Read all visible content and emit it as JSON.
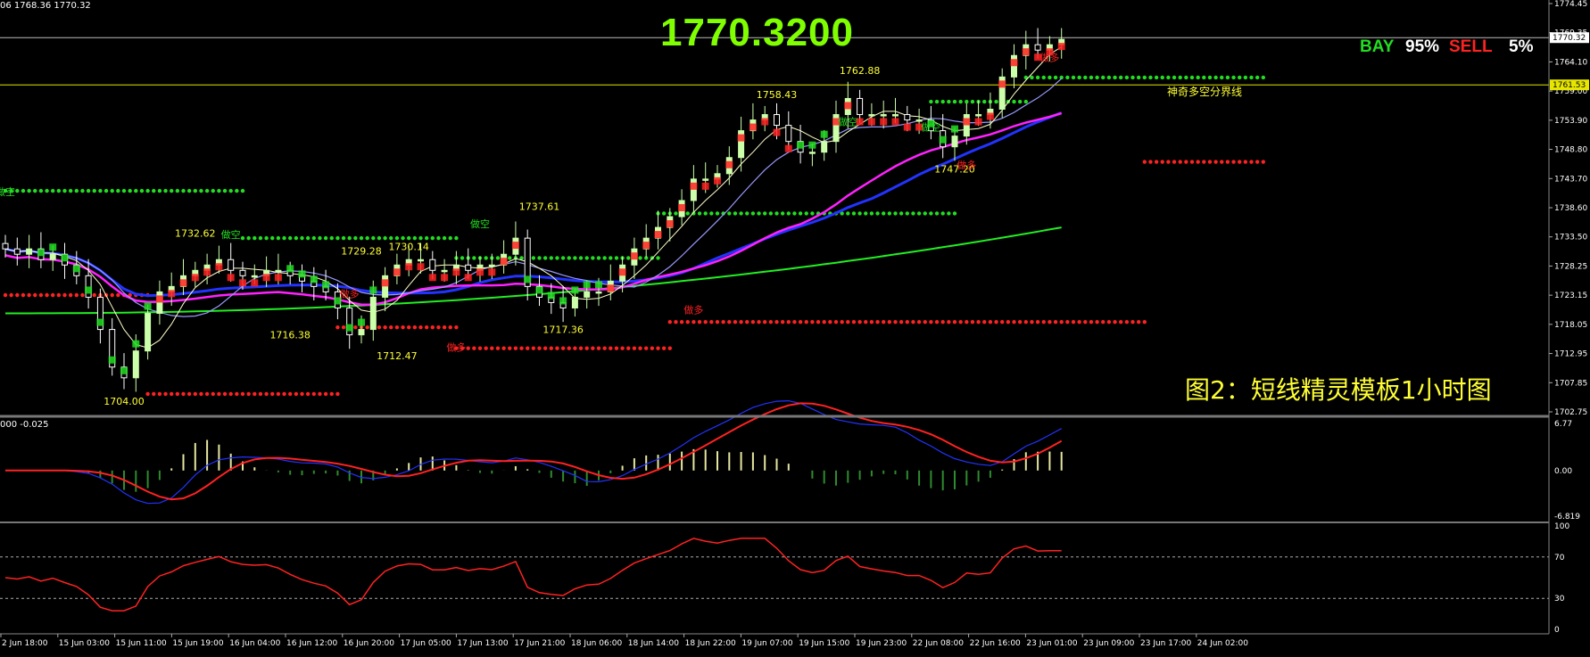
{
  "header": {
    "ohlc_text": "06 1768.36 1770.32",
    "big_price": "1770.3200",
    "bay_label": "BAY",
    "bay_pct": "95%",
    "sell_label": "SELL",
    "sell_pct": "5%"
  },
  "caption": "图2：短线精灵模板1小时图",
  "colors": {
    "bull": "#ccffaa",
    "bear": "#ffffff",
    "green_dots": "#22dd22",
    "red_dots": "#ff2222",
    "ma_blue": "#2233ff",
    "ma_magenta": "#ff22ff",
    "ma_green": "#22ee22",
    "accent_green": "#7fff00",
    "accent_red": "#ff2222",
    "caption_yellow": "#ffff33"
  },
  "chart_data": [
    {
      "type": "candlestick",
      "price_axis_ticks": [
        "1774.45",
        "1769.35",
        "1764.10",
        "1759.00",
        "1753.90",
        "1748.80",
        "1743.70",
        "1738.60",
        "1733.50",
        "1728.25",
        "1723.15",
        "1718.05",
        "1712.95",
        "1707.85",
        "1702.75"
      ],
      "current_price_tag": "1770.32",
      "boundary_price_tag": "1761.53",
      "boundary_label": "神奇多空分界线",
      "ylim": [
        1700.0,
        1776.0
      ],
      "time_labels": [
        "2 Jun 18:00",
        "15 Jun 03:00",
        "15 Jun 11:00",
        "15 Jun 19:00",
        "16 Jun 04:00",
        "16 Jun 12:00",
        "16 Jun 20:00",
        "17 Jun 05:00",
        "17 Jun 13:00",
        "17 Jun 21:00",
        "18 Jun 06:00",
        "18 Jun 14:00",
        "18 Jun 22:00",
        "19 Jun 07:00",
        "19 Jun 15:00",
        "19 Jun 23:00",
        "22 Jun 08:00",
        "22 Jun 16:00",
        "23 Jun 01:00",
        "23 Jun 09:00",
        "23 Jun 17:00",
        "24 Jun 02:00"
      ],
      "close": [
        1731,
        1730,
        1731,
        1729,
        1730,
        1728,
        1726,
        1722,
        1716,
        1709,
        1707,
        1712,
        1719,
        1723,
        1724,
        1726,
        1727,
        1728,
        1729,
        1727,
        1726,
        1726,
        1727,
        1727,
        1726,
        1725,
        1724,
        1723,
        1720,
        1715,
        1716,
        1722,
        1726,
        1728,
        1729,
        1729,
        1727,
        1727,
        1728,
        1727,
        1728,
        1728,
        1730,
        1733,
        1724,
        1722,
        1721,
        1720,
        1722,
        1723,
        1723,
        1725,
        1728,
        1731,
        1733,
        1735,
        1737,
        1740,
        1744,
        1744,
        1745,
        1748,
        1753,
        1755,
        1756,
        1754,
        1751,
        1749,
        1749,
        1751,
        1756,
        1759,
        1756,
        1756,
        1756,
        1756,
        1755,
        1755,
        1753,
        1750,
        1752,
        1756,
        1756,
        1757,
        1763,
        1767,
        1769,
        1768,
        1769,
        1770
      ],
      "annotations": [
        {
          "label": "1732.62",
          "price": 1732.62
        },
        {
          "label": "1729.28",
          "price": 1729.28
        },
        {
          "label": "1730.14",
          "price": 1730.14
        },
        {
          "label": "1737.61",
          "price": 1737.61
        },
        {
          "label": "1758.43",
          "price": 1758.43
        },
        {
          "label": "1762.88",
          "price": 1762.88
        },
        {
          "label": "1716.38",
          "price": 1716.38
        },
        {
          "label": "1712.47",
          "price": 1712.47
        },
        {
          "label": "1717.36",
          "price": 1717.36
        },
        {
          "label": "1747.20",
          "price": 1747.2
        },
        {
          "label": "1704.00",
          "price": 1704.0
        }
      ],
      "signals": [
        {
          "label": "做空",
          "bar": 0,
          "price": 1741,
          "color": "#22dd22"
        },
        {
          "label": "做空",
          "bar": 19,
          "price": 1733,
          "color": "#22dd22"
        },
        {
          "label": "做空",
          "bar": 40,
          "price": 1735,
          "color": "#22dd22"
        },
        {
          "label": "做空",
          "bar": 71,
          "price": 1754,
          "color": "#22dd22"
        },
        {
          "label": "做空",
          "bar": 78,
          "price": 1753,
          "color": "#22dd22"
        },
        {
          "label": "做多",
          "bar": 29,
          "price": 1722,
          "color": "#ff2222"
        },
        {
          "label": "做多",
          "bar": 38,
          "price": 1712,
          "color": "#ff2222"
        },
        {
          "label": "做多",
          "bar": 58,
          "price": 1719,
          "color": "#ff2222"
        },
        {
          "label": "做多",
          "bar": 81,
          "price": 1746,
          "color": "#ff2222"
        },
        {
          "label": "做多",
          "bar": 88,
          "price": 1766,
          "color": "#ff2222"
        }
      ],
      "support_resistance": [
        {
          "price": 1741.8,
          "from": 0,
          "to": 20,
          "kind": "green"
        },
        {
          "price": 1733.0,
          "from": 20,
          "to": 38,
          "kind": "green"
        },
        {
          "price": 1729.3,
          "from": 38,
          "to": 55,
          "kind": "green"
        },
        {
          "price": 1737.6,
          "from": 55,
          "to": 80,
          "kind": "green"
        },
        {
          "price": 1758.4,
          "from": 78,
          "to": 86,
          "kind": "green"
        },
        {
          "price": 1762.9,
          "from": 86,
          "to": 106,
          "kind": "green"
        },
        {
          "price": 1722.4,
          "from": 0,
          "to": 12,
          "kind": "red"
        },
        {
          "price": 1704.0,
          "from": 12,
          "to": 28,
          "kind": "red"
        },
        {
          "price": 1716.4,
          "from": 28,
          "to": 38,
          "kind": "red"
        },
        {
          "price": 1712.5,
          "from": 38,
          "to": 56,
          "kind": "red"
        },
        {
          "price": 1717.4,
          "from": 56,
          "to": 96,
          "kind": "red"
        },
        {
          "price": 1747.2,
          "from": 96,
          "to": 106,
          "kind": "red"
        }
      ]
    },
    {
      "type": "histogram",
      "label": "000 -0.025",
      "yticks": [
        "6.77",
        "0.00",
        "-6.819"
      ],
      "ylim": [
        -6.819,
        6.77
      ]
    },
    {
      "type": "line",
      "yticks": [
        "100",
        "70",
        "30",
        "0"
      ],
      "levels": [
        70,
        30
      ],
      "ylim": [
        0,
        100
      ]
    }
  ]
}
